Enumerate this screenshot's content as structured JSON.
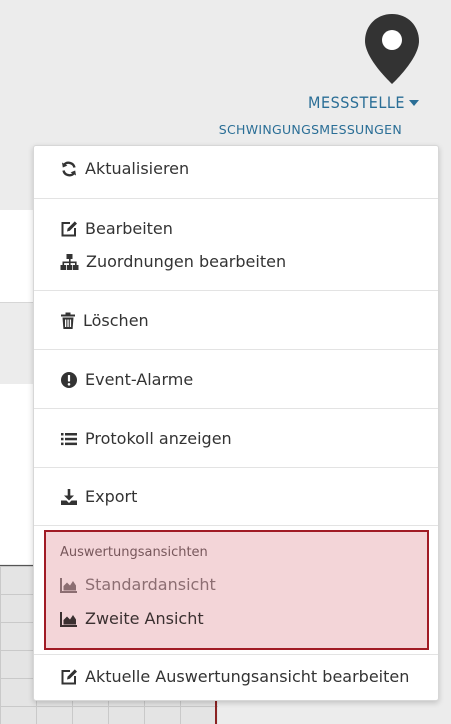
{
  "header": {
    "station_label": "MESSSTELLE",
    "station_subtitle": "SCHWINGUNGSMESSUNGEN"
  },
  "menu": {
    "refresh": "Aktualisieren",
    "edit": "Bearbeiten",
    "edit_assignments": "Zuordnungen bearbeiten",
    "delete": "Löschen",
    "event_alarms": "Event-Alarme",
    "show_log": "Protokoll anzeigen",
    "export": "Export",
    "views_group_title": "Auswertungsansichten",
    "views": [
      {
        "label": "Standardansicht",
        "state": "disabled"
      },
      {
        "label": "Zweite Ansicht",
        "state": "enabled"
      }
    ],
    "edit_current_view": "Aktuelle Auswertungsansicht bearbeiten"
  },
  "colors": {
    "accent": "#2a6e96",
    "highlight_bg": "#f3d5d8",
    "highlight_border": "#a01b25"
  }
}
